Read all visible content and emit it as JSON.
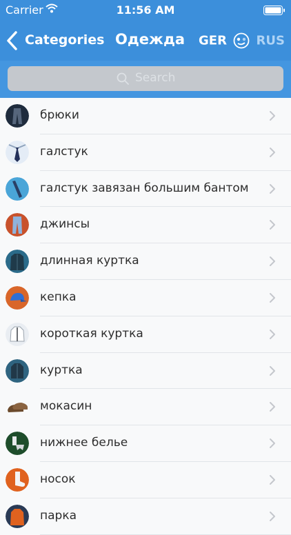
{
  "status_bar": {
    "carrier": "Carrier",
    "time": "11:56 AM"
  },
  "nav": {
    "back_label": "Categories",
    "title": "Одежда",
    "lang_from": "GER",
    "lang_to": "RUS"
  },
  "search": {
    "placeholder": "Search"
  },
  "items": [
    {
      "label": "брюки",
      "icon": "trousers"
    },
    {
      "label": "галстук",
      "icon": "tie"
    },
    {
      "label": "галстук завязан большим бантом",
      "icon": "bow-tie"
    },
    {
      "label": "джинсы",
      "icon": "jeans"
    },
    {
      "label": "длинная куртка",
      "icon": "long-jacket"
    },
    {
      "label": "кепка",
      "icon": "cap"
    },
    {
      "label": "короткая куртка",
      "icon": "short-jacket"
    },
    {
      "label": "куртка",
      "icon": "jacket"
    },
    {
      "label": "мокасин",
      "icon": "moccasin"
    },
    {
      "label": "нижнее белье",
      "icon": "underwear"
    },
    {
      "label": "носок",
      "icon": "sock"
    },
    {
      "label": "парка",
      "icon": "parka"
    }
  ],
  "colors": {
    "header": "#3c8fdb",
    "search_bar": "#4496e0",
    "search_field": "#c4c8cd",
    "list_bg": "#f8f9fa",
    "separator": "#e1e4e8"
  }
}
